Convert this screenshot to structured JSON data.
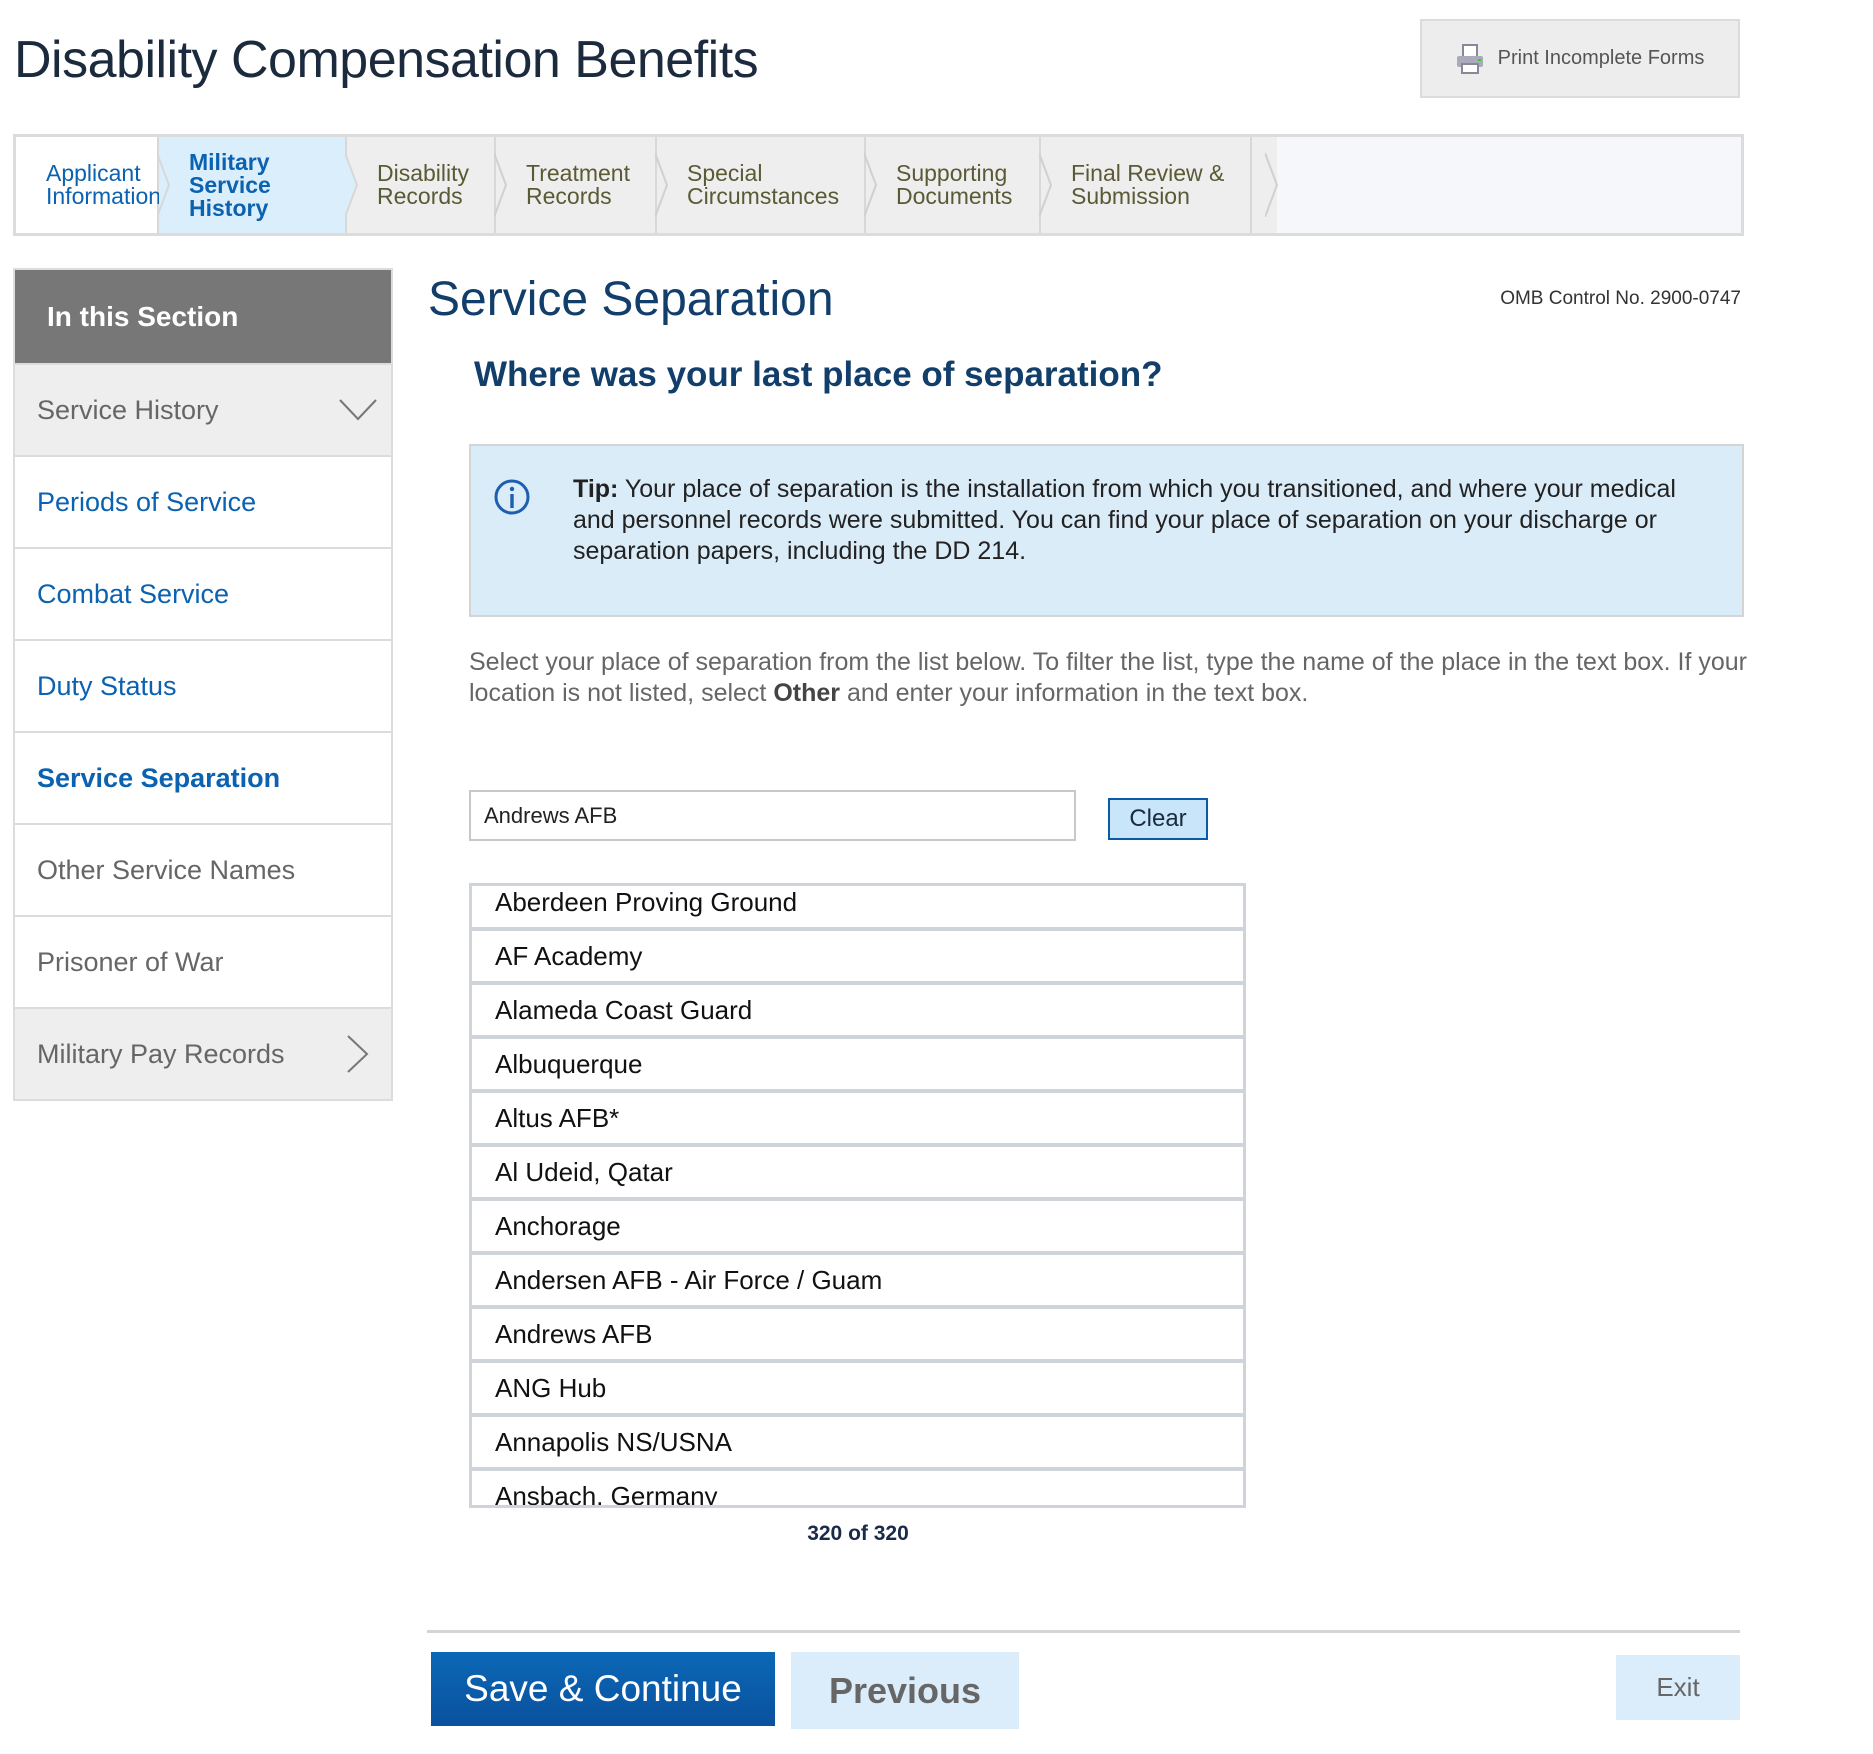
{
  "header": {
    "title": "Disability Compensation Benefits",
    "print_label": "Print Incomplete Forms",
    "print_icon": "printer-icon"
  },
  "tabs": [
    {
      "label": "Applicant\nInformation",
      "state": "done"
    },
    {
      "label": "Military Service\nHistory",
      "state": "active"
    },
    {
      "label": "Disability\nRecords",
      "state": "pending"
    },
    {
      "label": "Treatment\nRecords",
      "state": "pending"
    },
    {
      "label": "Special\nCircumstances",
      "state": "pending"
    },
    {
      "label": "Supporting\nDocuments",
      "state": "pending"
    },
    {
      "label": "Final Review &\nSubmission",
      "state": "pending"
    }
  ],
  "sidebar": {
    "heading": "In this Section",
    "items": [
      {
        "label": "Service History",
        "icon": "chevron-down-icon"
      },
      {
        "label": "Periods of Service"
      },
      {
        "label": "Combat Service"
      },
      {
        "label": "Duty Status"
      },
      {
        "label": "Service Separation",
        "current": true
      },
      {
        "label": "Other Service Names"
      },
      {
        "label": "Prisoner of War"
      },
      {
        "label": "Military Pay Records",
        "icon": "chevron-right-icon"
      }
    ]
  },
  "main": {
    "title": "Service Separation",
    "omb": "OMB Control No. 2900-0747",
    "question": "Where was your last place of separation?",
    "tip_label": "Tip:",
    "tip_text": " Your place of separation is the installation from which you transitioned, and where your medical and personnel records were submitted. You can find your place of separation on your discharge or separation papers, including the DD 214.",
    "instr_1": "Select your place of separation from the list below. To filter the list, type the name of the place in the text box. If your location is not listed, select ",
    "instr_bold": "Other",
    "instr_2": " and enter your information in the text box.",
    "filter_value": "Andrews AFB",
    "clear_label": "Clear",
    "options": [
      "Aberdeen Proving Ground",
      "AF Academy",
      "Alameda Coast Guard",
      "Albuquerque",
      "Altus AFB*",
      "Al Udeid, Qatar",
      "Anchorage",
      "Andersen AFB - Air Force / Guam",
      "Andrews AFB",
      "ANG Hub",
      "Annapolis NS/USNA",
      "Ansbach, Germany"
    ],
    "count": "320 of 320"
  },
  "footer": {
    "save_label": "Save & Continue",
    "previous_label": "Previous",
    "exit_label": "Exit"
  },
  "colors": {
    "accent": "#0b62b0",
    "heading": "#113e6a",
    "tip_bg": "#dbecf9",
    "active_tab_bg": "#dbeefb"
  }
}
